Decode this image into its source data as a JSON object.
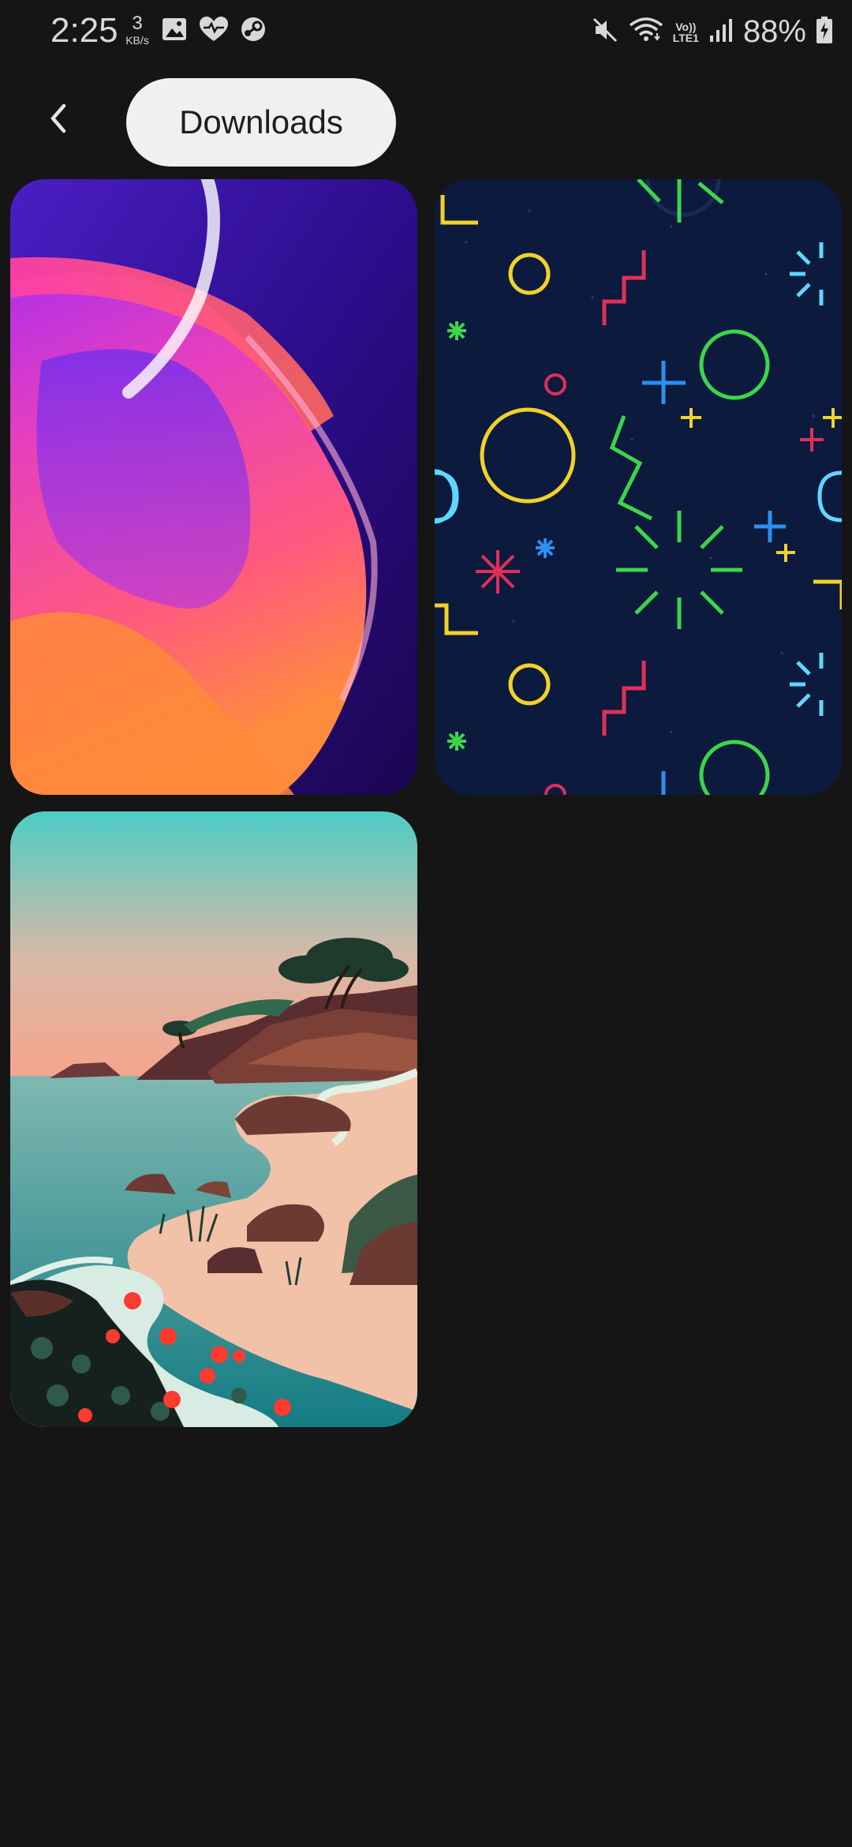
{
  "status_bar": {
    "time": "2:25",
    "net_speed_value": "3",
    "net_speed_unit": "KB/s",
    "volte_top": "Vo))",
    "volte_bottom": "LTE1",
    "battery_percent": "88%",
    "left_icons": [
      "gallery-icon",
      "heart-icon",
      "steam-icon"
    ],
    "right_icons": [
      "mute-icon",
      "wifi-icon",
      "volte-icon",
      "signal-icon",
      "battery-icon"
    ]
  },
  "header": {
    "back_icon": "chevron-left-icon",
    "title": "Downloads"
  },
  "wallpapers": [
    {
      "name": "purple-orange-abstract"
    },
    {
      "name": "neon-geometric-pattern"
    },
    {
      "name": "coastal-landscape"
    }
  ],
  "colors": {
    "background": "#151515",
    "pill": "#f0f0f0"
  }
}
